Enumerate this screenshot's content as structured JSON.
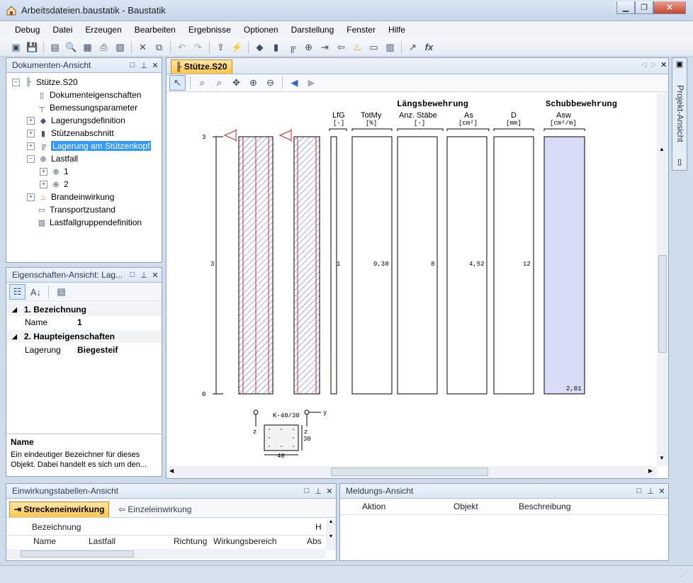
{
  "window": {
    "title": "Arbeitsdateien.baustatik - Baustatik"
  },
  "menu": [
    "Debug",
    "Datei",
    "Erzeugen",
    "Bearbeiten",
    "Ergebnisse",
    "Optionen",
    "Darstellung",
    "Fenster",
    "Hilfe"
  ],
  "doc_panel": {
    "title": "Dokumenten-Ansicht",
    "root": "Stütze.S20",
    "items": [
      "Dokumenteigenschaften",
      "Bemessungsparameter",
      "Lagerungsdefinition",
      "Stützenabschnitt",
      "Lagerung am Stützenkopf",
      "Lastfall",
      "1",
      "2",
      "Brandeinwirkung",
      "Transportzustand",
      "Lastfallgruppendefinition"
    ],
    "selected": "Lagerung am Stützenkopf"
  },
  "prop_panel": {
    "title": "Eigenschaften-Ansicht: Lag...",
    "group1": "1. Bezeichnung",
    "name_label": "Name",
    "name_value": "1",
    "group2": "2. Haupteigenschaften",
    "lagerung_label": "Lagerung",
    "lagerung_value": "Biegesteif",
    "help_title": "Name",
    "help_text": "Ein eindeutiger Bezeichner für dieses Objekt. Dabei handelt es sich um den..."
  },
  "doc_tab": "Stütze.S20",
  "side_tab": "Projekt-Ansicht",
  "drawing": {
    "heading_long": "Längsbewehrung",
    "heading_shear": "Schubbewehrung",
    "columns": [
      {
        "name": "LfG",
        "unit": "[-]",
        "value": "1"
      },
      {
        "name": "TotMy",
        "unit": "[%]",
        "value": "0,38"
      },
      {
        "name": "Anz. Stäbe",
        "unit": "[-]",
        "value": "8"
      },
      {
        "name": "As",
        "unit": "[cm²]",
        "value": "4,52"
      },
      {
        "name": "D",
        "unit": "[mm]",
        "value": "12"
      },
      {
        "name": "Asw",
        "unit": "[cm²/m]",
        "value": "2,01"
      }
    ],
    "axis_top": "3",
    "axis_mid": "3",
    "axis_bottom": "0",
    "section_label": "K-40/30",
    "section_width": "40",
    "section_height": "30",
    "axis_y": "y",
    "axis_z1": "z",
    "axis_z2": "z"
  },
  "einwirkung_panel": {
    "title": "Einwirkungstabellen-Ansicht",
    "tab_active": "Streckeneinwirkung",
    "tab_other": "Einzeleinwirkung",
    "header1": "Bezeichnung",
    "header1_right": "H",
    "cols": [
      "Name",
      "Lastfall",
      "Richtung",
      "Wirkungsbereich",
      "Abs"
    ]
  },
  "meldung_panel": {
    "title": "Meldungs-Ansicht",
    "cols": [
      "Aktion",
      "Objekt",
      "Beschreibung"
    ]
  }
}
